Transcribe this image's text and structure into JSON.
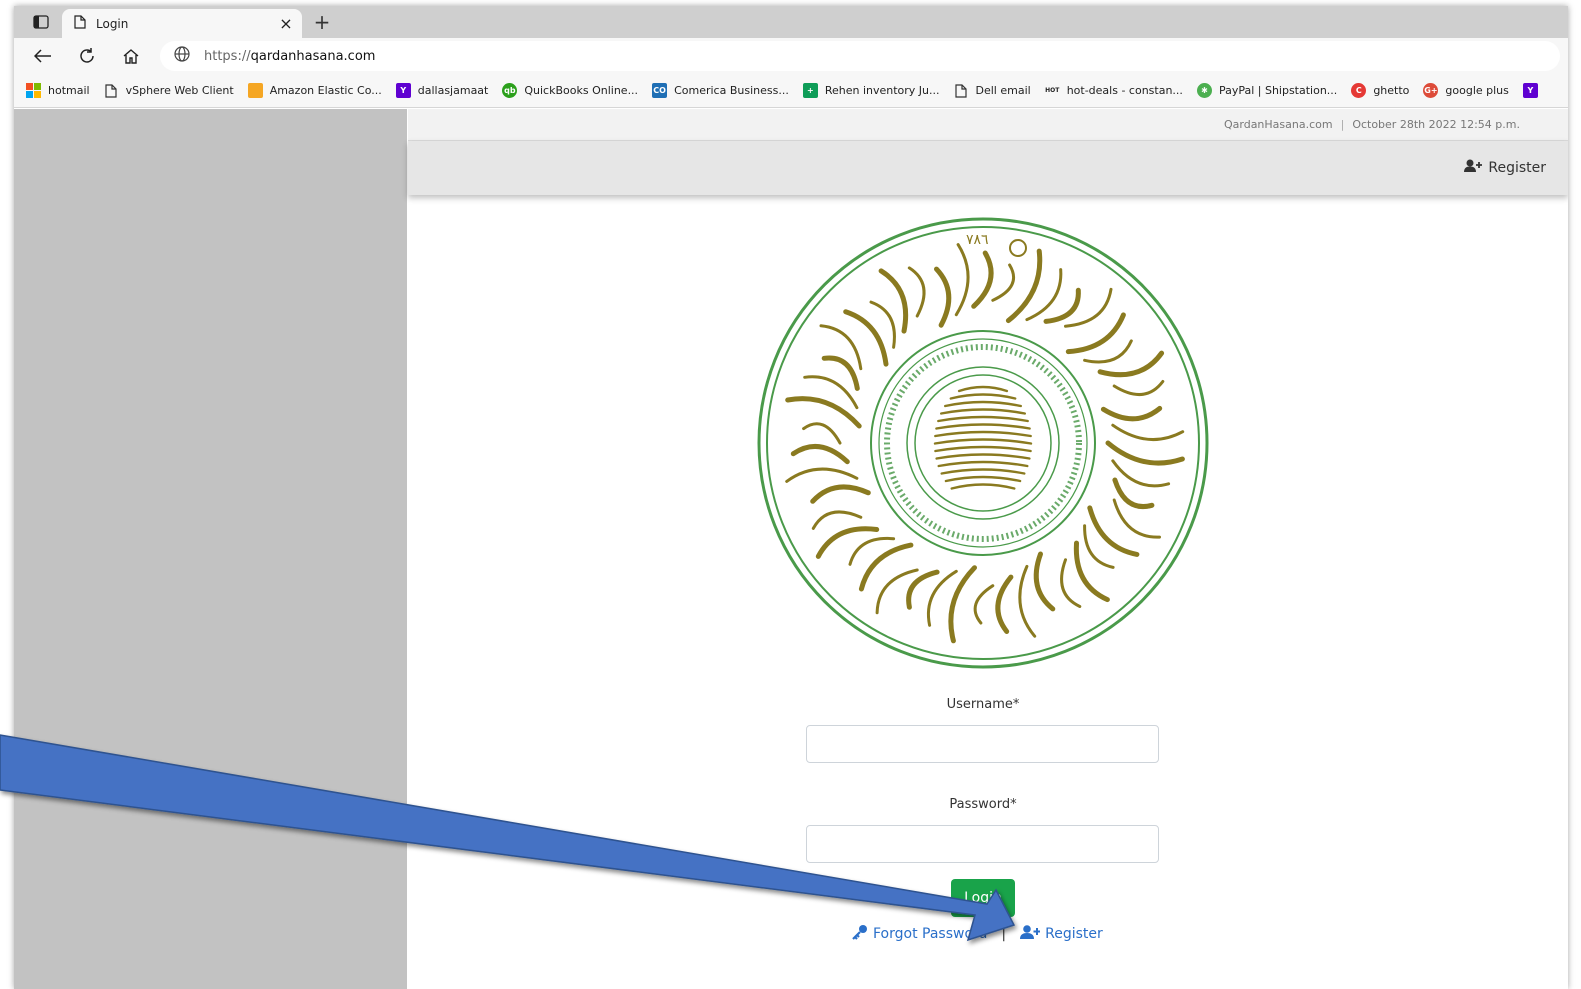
{
  "browser": {
    "tab_title": "Login",
    "tab_close": "×",
    "new_tab": "+",
    "url_scheme": "https://",
    "url_host": "qardanhasana.com"
  },
  "bookmarks": [
    {
      "label": "hotmail",
      "icon": "windows-logo-icon",
      "color": "#f25022"
    },
    {
      "label": "vSphere Web Client",
      "icon": "page-icon",
      "color": "#555555"
    },
    {
      "label": "Amazon Elastic Co...",
      "icon": "aws-box-icon",
      "color": "#f5a623"
    },
    {
      "label": "dallasjamaat",
      "icon": "yahoo-icon",
      "color": "#5f01d1"
    },
    {
      "label": "QuickBooks Online...",
      "icon": "quickbooks-icon",
      "color": "#2ca01c"
    },
    {
      "label": "Comerica Business...",
      "icon": "comerica-icon",
      "color": "#1f6fb5"
    },
    {
      "label": "Rehen inventory Ju...",
      "icon": "sheets-plus-icon",
      "color": "#0f9d58"
    },
    {
      "label": "Dell email",
      "icon": "page-icon",
      "color": "#555555"
    },
    {
      "label": "hot-deals - constan...",
      "icon": "hot-deals-icon",
      "color": "#222222"
    },
    {
      "label": "PayPal | Shipstation...",
      "icon": "gear-green-icon",
      "color": "#4caf50"
    },
    {
      "label": "ghetto",
      "icon": "c-red-icon",
      "color": "#e53935"
    },
    {
      "label": "google plus",
      "icon": "google-plus-icon",
      "color": "#dd4b39"
    },
    {
      "label": "",
      "icon": "yahoo-icon",
      "color": "#5f01d1"
    }
  ],
  "site": {
    "top_site": "QardanHasana.com",
    "top_date": "October 28th 2022 12:54 p.m.",
    "header_register": "Register",
    "logo_numerals": "٧٨٦",
    "username_label": "Username*",
    "password_label": "Password*",
    "login_button": "Login",
    "forgot_password": "Forgot Password",
    "pipe": "|",
    "register_link": "Register",
    "colors": {
      "login_green": "#19a34a",
      "link_blue": "#2a6fc9",
      "seal_green": "#4a9a4a",
      "seal_gold": "#8a7a20",
      "arrow_blue": "#4472c4"
    }
  }
}
